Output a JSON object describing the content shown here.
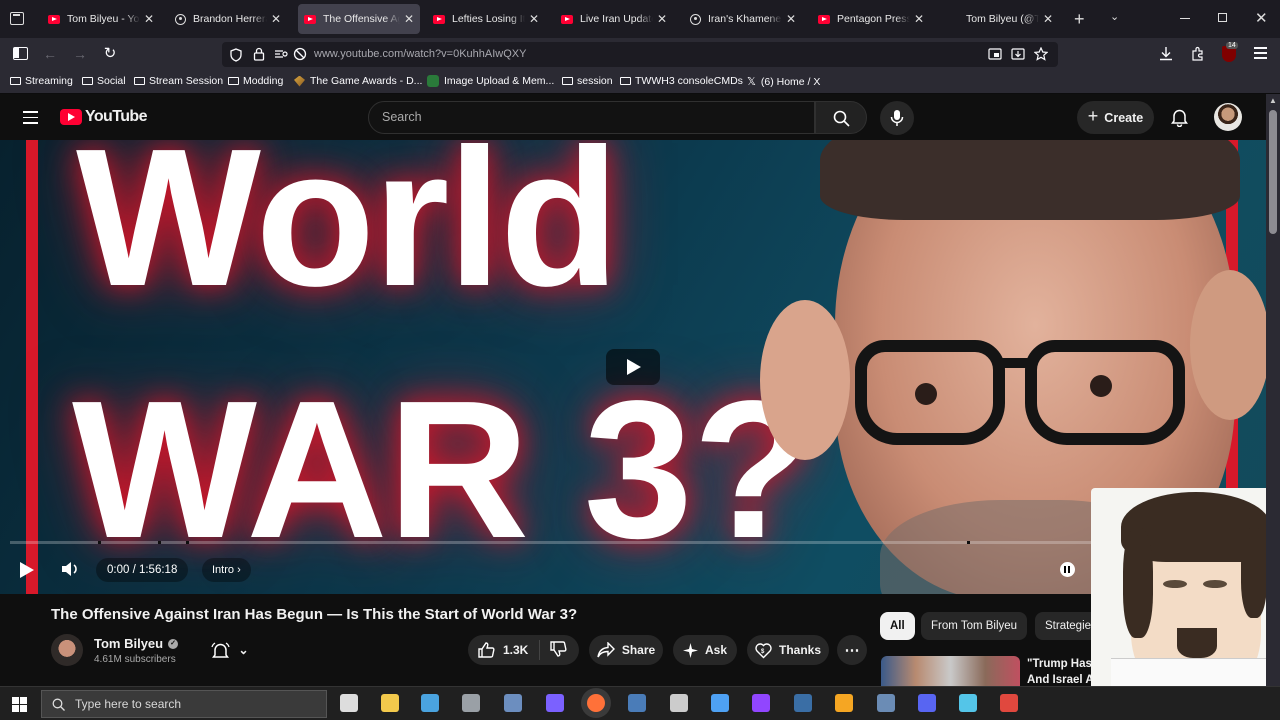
{
  "browser": {
    "tabs": [
      {
        "title": "Tom Bilyeu - YouTube",
        "icon": "youtube-favicon",
        "active": false
      },
      {
        "title": "Brandon Herrera",
        "icon": "podcast-favicon",
        "active": false
      },
      {
        "title": "The Offensive Against Iran",
        "icon": "youtube-favicon",
        "active": true
      },
      {
        "title": "Lefties Losing It: Iran",
        "icon": "youtube-favicon",
        "active": false
      },
      {
        "title": "Live Iran Update with",
        "icon": "youtube-favicon",
        "active": false
      },
      {
        "title": "Iran's Khamenei",
        "icon": "podcast-favicon",
        "active": false
      },
      {
        "title": "Pentagon Press Briefing",
        "icon": "youtube-favicon",
        "active": false
      },
      {
        "title": "Tom Bilyeu (@TomBilyeu)",
        "icon": "x-favicon",
        "active": false
      }
    ],
    "url": "www.youtube.com/watch?v=0KuhhAIwQXY",
    "extension_badge": "14",
    "bookmarks": [
      {
        "label": "Streaming",
        "icon": "folder-icon"
      },
      {
        "label": "Social",
        "icon": "folder-icon"
      },
      {
        "label": "Stream Session",
        "icon": "folder-icon"
      },
      {
        "label": "Modding",
        "icon": "folder-icon"
      },
      {
        "label": "The Game Awards - D...",
        "icon": "game-awards-icon"
      },
      {
        "label": "Image Upload & Mem...",
        "icon": "imgflip-icon"
      },
      {
        "label": "session",
        "icon": "folder-icon"
      },
      {
        "label": "TWWH3 consoleCMDs",
        "icon": "folder-icon"
      },
      {
        "label": "(6) Home / X",
        "icon": "x-icon"
      }
    ]
  },
  "youtube": {
    "logo_text": "YouTube",
    "search_placeholder": "Search",
    "create_label": "Create",
    "video": {
      "thumbnail_line1": "World",
      "thumbnail_line2": "WAR 3?",
      "time": "0:00 / 1:56:18",
      "chapter": "Intro",
      "progress": 0
    },
    "title": "The Offensive Against Iran Has Begun — Is This the Start of World War 3?",
    "channel": {
      "name": "Tom Bilyeu",
      "subscribers": "4.61M subscribers"
    },
    "actions": {
      "likes": "1.3K",
      "share": "Share",
      "ask": "Ask",
      "thanks": "Thanks"
    },
    "chips": [
      "All",
      "From Tom Bilyeu",
      "Strategie"
    ],
    "recommended_snippet": {
      "line1": "\"Trump Has",
      "line2": "And Israel A"
    }
  },
  "taskbar": {
    "search_placeholder": "Type here to search"
  },
  "colors": {
    "yt_red": "#ff0033",
    "bg": "#0f0f0f",
    "chrome_dark": "#1c1b22",
    "chrome_mid": "#2b2a33"
  }
}
